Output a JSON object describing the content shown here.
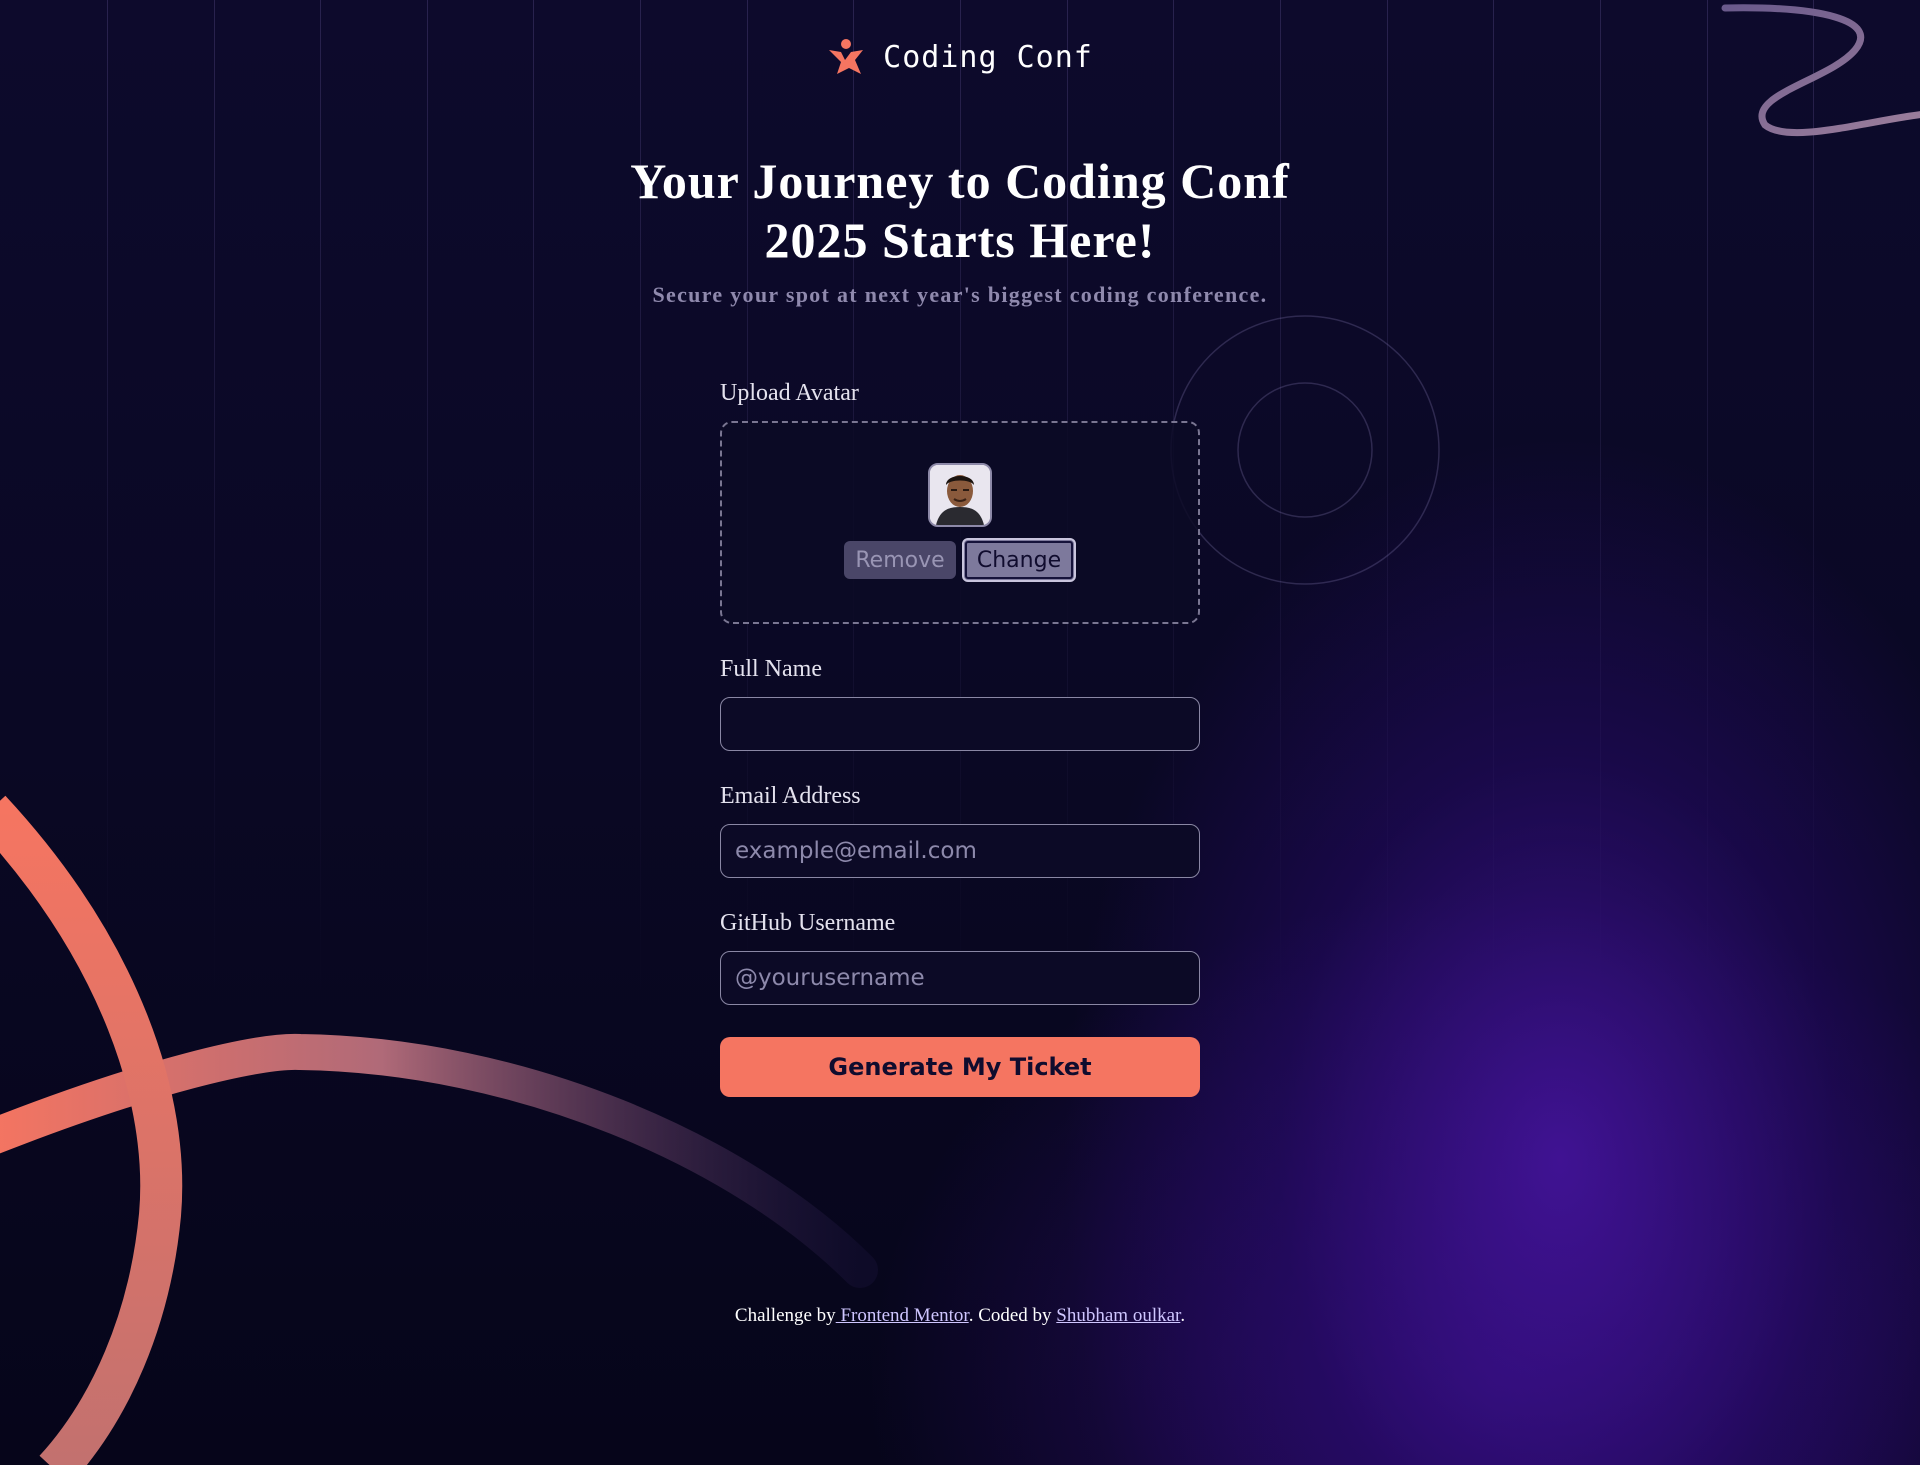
{
  "brand": {
    "name": "Coding Conf",
    "icon": "coding-conf-logo-icon",
    "accent_color": "#f57561"
  },
  "hero": {
    "title_line1": "Your Journey to Coding Conf",
    "title_line2": "2025 Starts Here!",
    "subtitle": "Secure your spot at next year's biggest coding conference."
  },
  "form": {
    "avatar": {
      "label": "Upload Avatar",
      "remove_label": "Remove",
      "change_label": "Change"
    },
    "full_name": {
      "label": "Full Name",
      "value": "",
      "placeholder": ""
    },
    "email": {
      "label": "Email Address",
      "value": "",
      "placeholder": "example@email.com"
    },
    "github": {
      "label": "GitHub Username",
      "value": "",
      "placeholder": "@yourusername"
    },
    "submit_label": "Generate My Ticket"
  },
  "footer": {
    "prefix": "Challenge by",
    "link1": " Frontend Mentor",
    "middle": ". Coded by ",
    "link2": "Shubham oulkar",
    "suffix": "."
  }
}
